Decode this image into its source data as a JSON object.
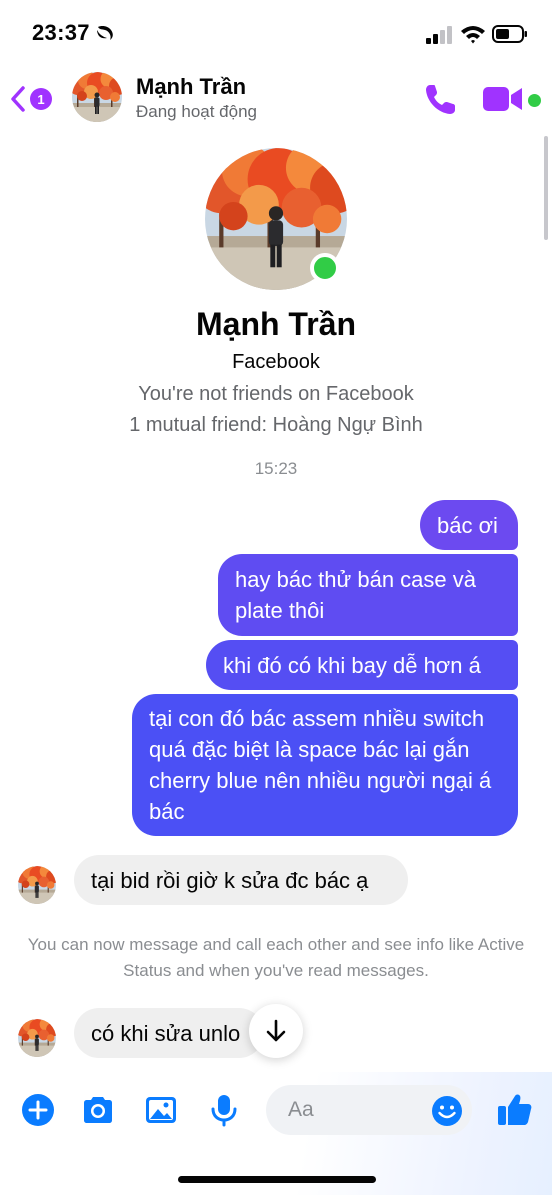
{
  "status_bar": {
    "time": "23:37"
  },
  "header": {
    "back_badge": "1",
    "contact_name": "Mạnh Trần",
    "contact_status": "Đang hoạt động"
  },
  "profile": {
    "name": "Mạnh Trần",
    "platform": "Facebook",
    "friend_status": "You're not friends on Facebook",
    "mutual_friends": "1 mutual friend: Hoàng Ngự Bình"
  },
  "timestamp": "15:23",
  "messages": [
    {
      "direction": "outgoing",
      "text": "bác ơi"
    },
    {
      "direction": "outgoing",
      "text": "hay bác thử bán case và plate thôi"
    },
    {
      "direction": "outgoing",
      "text": "khi đó có khi bay dễ hơn á"
    },
    {
      "direction": "outgoing",
      "text": "tại con đó bác assem nhiều switch quá đặc biệt là space bác lại gắn cherry blue nên nhiều người ngại á bác"
    },
    {
      "direction": "incoming",
      "text": "tại bid rồi giờ k sửa đc bác ạ"
    },
    {
      "direction": "incoming",
      "text": "có khi sửa unlo"
    }
  ],
  "info_notice": "You can now message and call each other and see info like Active Status and when you've read messages.",
  "composer": {
    "placeholder": "Aa"
  },
  "colors": {
    "accent": "#a033ff",
    "online": "#31cc46",
    "outgoing_bubble_top": "#6c4af0",
    "outgoing_bubble_bottom": "#4b50f5",
    "composer_icon": "#0a7cff"
  },
  "icons": [
    "moon-icon",
    "signal-icon",
    "wifi-icon",
    "battery-icon",
    "back-chevron-icon",
    "phone-icon",
    "video-camera-icon",
    "arrow-down-icon",
    "plus-icon",
    "camera-icon",
    "gallery-icon",
    "microphone-icon",
    "emoji-icon",
    "thumbs-up-icon"
  ]
}
